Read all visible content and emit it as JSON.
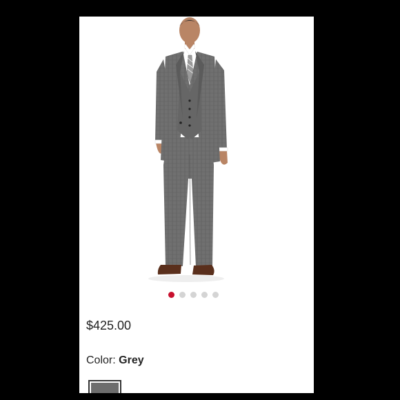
{
  "product": {
    "price": "$425.00",
    "image_alt": "Model wearing grey three-piece suit",
    "color_label": "Color:",
    "color_value": "Grey"
  },
  "carousel": {
    "total": 5,
    "active_index": 0
  },
  "colors": {
    "accent": "#c8102e",
    "dot_inactive": "#d4d4d4",
    "swatch_grey": "#6d6d6d"
  },
  "icons": {
    "product_photo": "suit-model-image"
  }
}
